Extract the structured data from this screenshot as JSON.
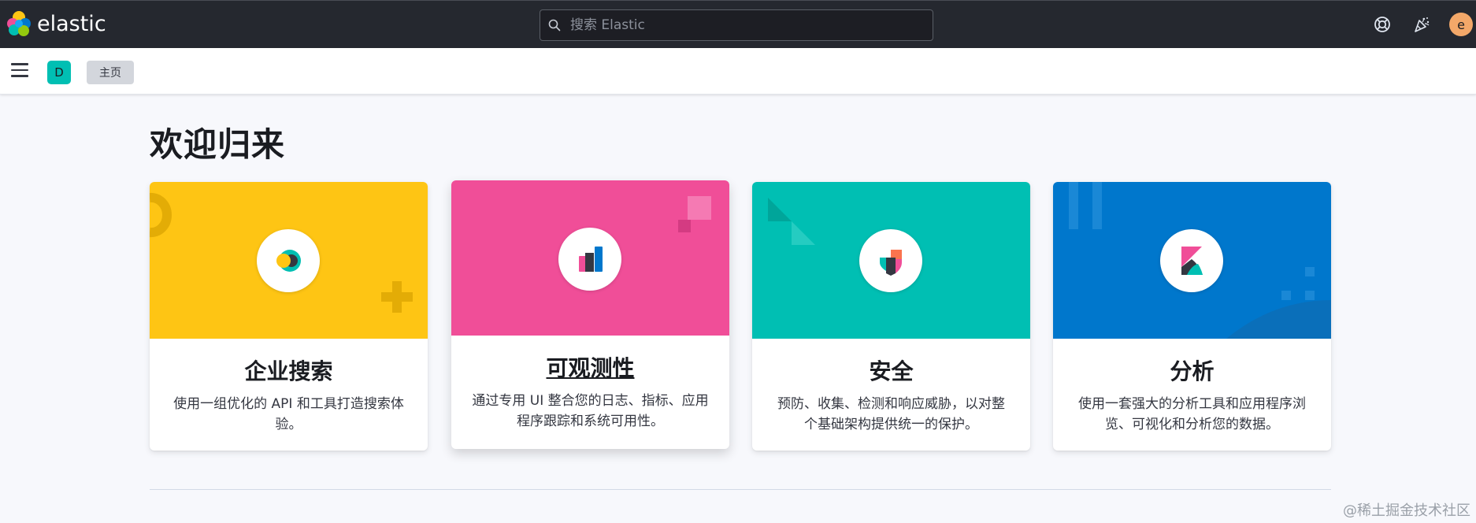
{
  "header": {
    "brand": "elastic",
    "search": {
      "placeholder": "搜索 Elastic"
    },
    "avatar_initial": "e",
    "icons": [
      "help-icon",
      "newsfeed-icon"
    ]
  },
  "subheader": {
    "space_initial": "D",
    "breadcrumb": "主页"
  },
  "main": {
    "title": "欢迎归来",
    "cards": [
      {
        "title": "企业搜索",
        "description": "使用一组优化的 API 和工具打造搜索体验。",
        "color": "#fec514",
        "icon": "enterprise-search-icon"
      },
      {
        "title": "可观测性",
        "description": "通过专用 UI 整合您的日志、指标、应用程序跟踪和系统可用性。",
        "color": "#f04e98",
        "icon": "observability-icon"
      },
      {
        "title": "安全",
        "description": "预防、收集、检测和响应威胁，以对整个基础架构提供统一的保护。",
        "color": "#00bfb3",
        "icon": "security-icon"
      },
      {
        "title": "分析",
        "description": "使用一套强大的分析工具和应用程序浏览、可视化和分析您的数据。",
        "color": "#0077cc",
        "icon": "kibana-icon"
      }
    ]
  },
  "watermark": "@稀土掘金技术社区"
}
